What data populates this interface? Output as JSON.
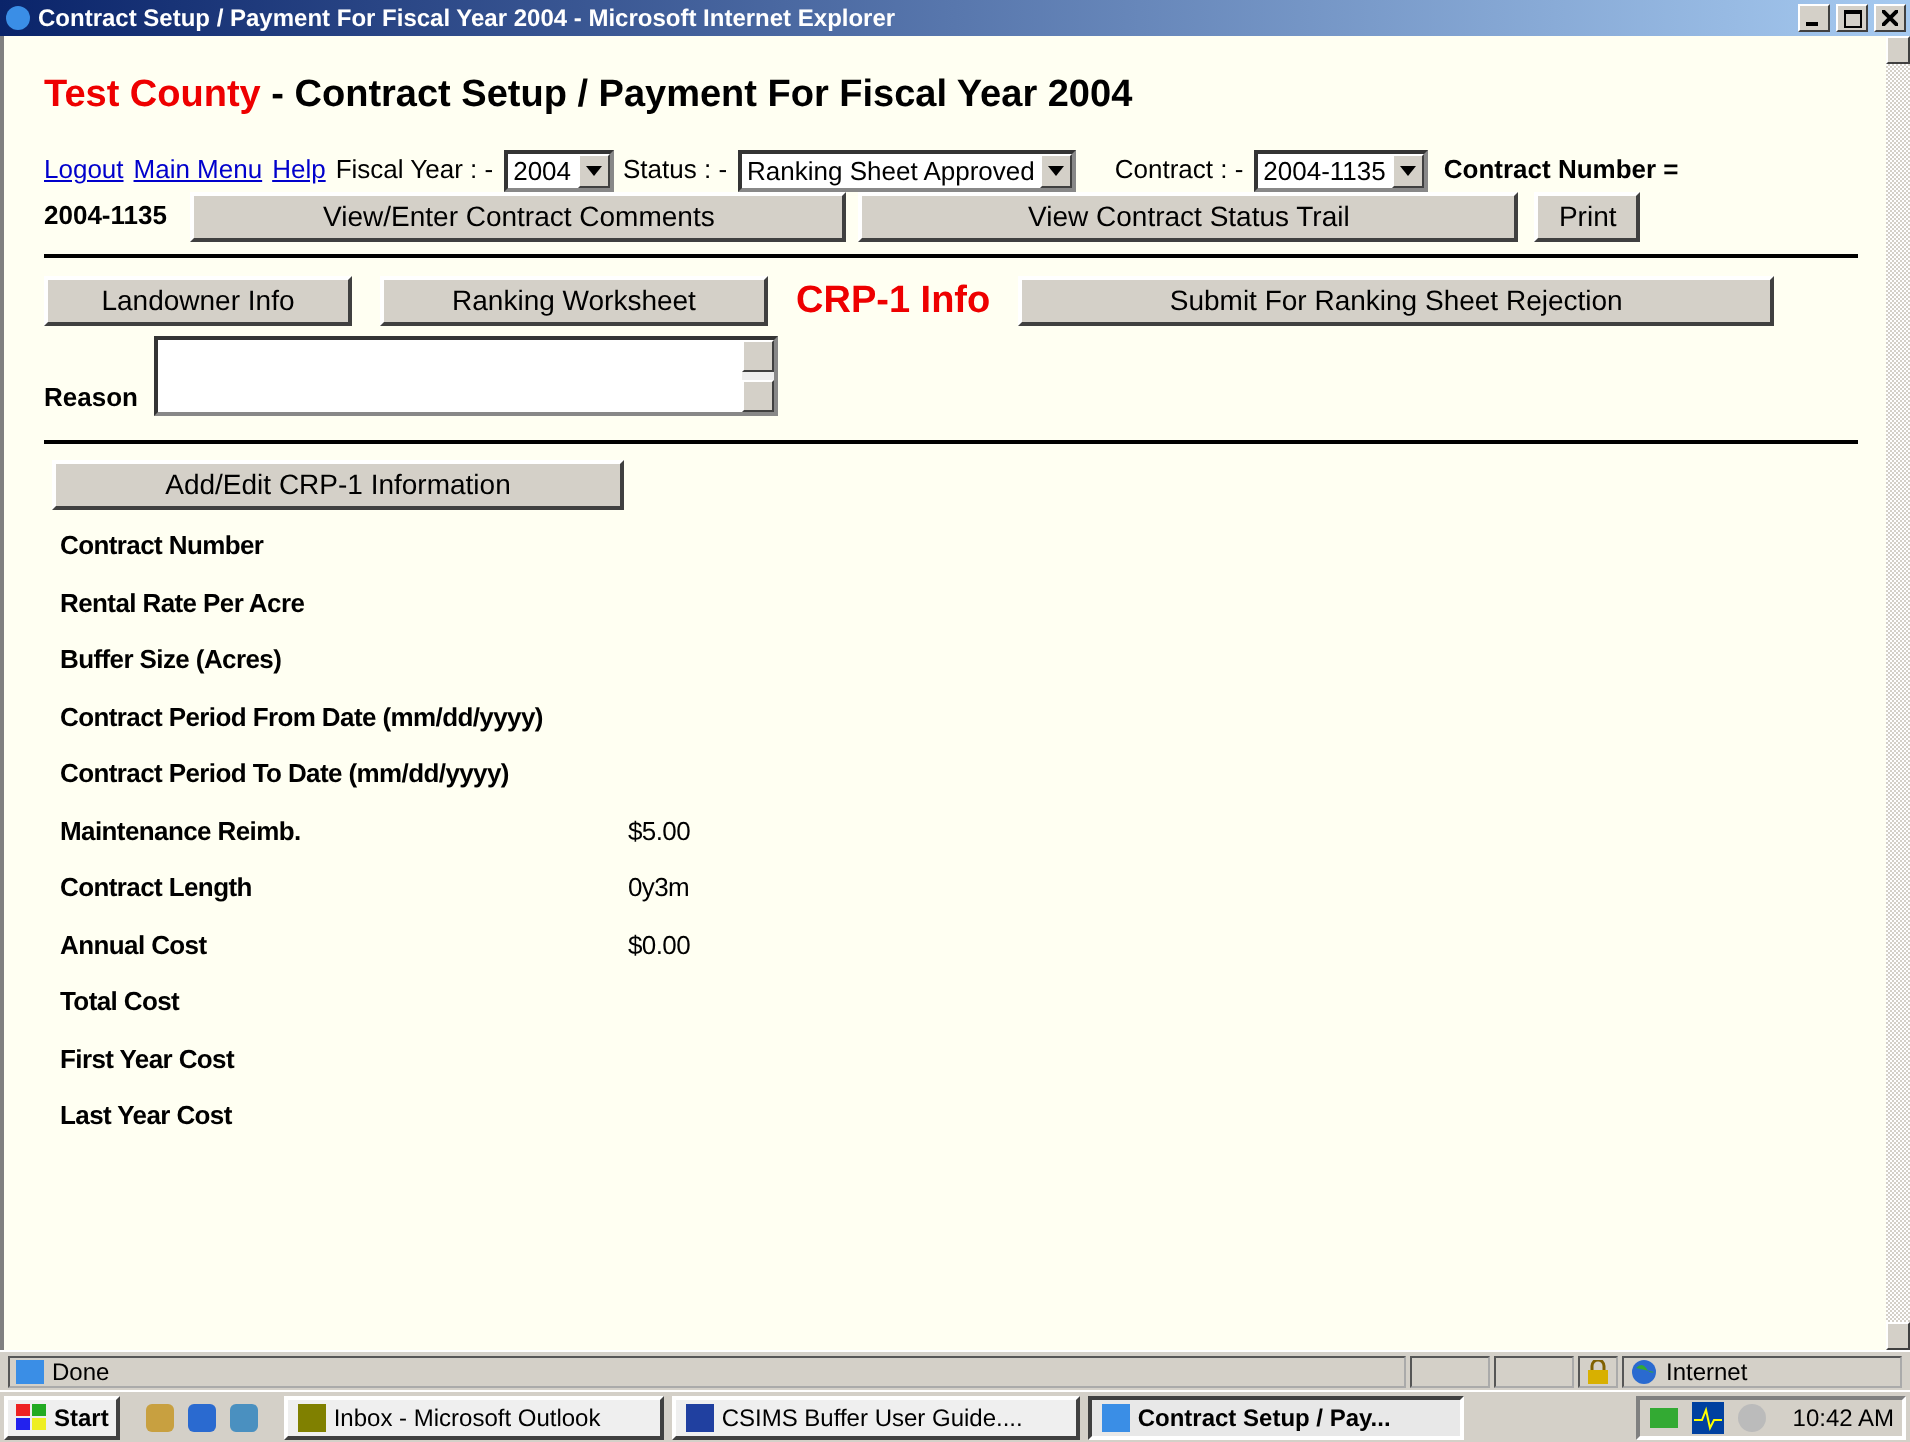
{
  "window": {
    "title": "Contract Setup / Payment For Fiscal Year 2004 - Microsoft Internet Explorer"
  },
  "heading": {
    "county": "Test County",
    "title": "- Contract Setup / Payment For Fiscal Year 2004"
  },
  "links": [
    "Logout",
    "Main Menu",
    "Help"
  ],
  "filters": [
    {
      "label": "Fiscal Year : -",
      "value": "2004"
    },
    {
      "label": "Status : -",
      "value": "Ranking Sheet Approved"
    },
    {
      "label": "Contract : -",
      "value": "2004-1135"
    }
  ],
  "contract_number": {
    "label": "Contract Number =",
    "value": "2004-1135"
  },
  "action_buttons": [
    "View/Enter Contract Comments",
    "View Contract Status Trail",
    "Print"
  ],
  "tabs": [
    {
      "label": "Landowner Info",
      "selected": false
    },
    {
      "label": "Ranking Worksheet",
      "selected": false
    },
    {
      "label": "CRP-1 Info",
      "selected": true
    }
  ],
  "reject_button": "Submit For Ranking Sheet Rejection",
  "reason": {
    "label": "Reason"
  },
  "edit_button": "Add/Edit CRP-1 Information",
  "fields": [
    {
      "label": "Contract Number"
    },
    {
      "label": "Rental Rate Per Acre"
    },
    {
      "label": "Buffer Size (Acres)"
    },
    {
      "label": "Contract Period From Date (mm/dd/yyyy)"
    },
    {
      "label": "Contract Period To Date (mm/dd/yyyy)"
    },
    {
      "label": "Maintenance Reimb.",
      "value": "$5.00"
    },
    {
      "label": "Contract Length",
      "value": "0y3m"
    },
    {
      "label": "Annual Cost",
      "value": "$0.00"
    },
    {
      "label": "Total Cost"
    },
    {
      "label": "First Year Cost"
    },
    {
      "label": "Last Year Cost"
    }
  ],
  "status_bar": {
    "text": "Done",
    "zone": "Internet"
  },
  "taskbar": {
    "start": "Start",
    "tasks": [
      {
        "label": "Inbox - Microsoft Outlook",
        "selected": false
      },
      {
        "label": "CSIMS Buffer User Guide....",
        "selected": false
      },
      {
        "label": "Contract Setup / Pay...",
        "selected": true
      }
    ],
    "clock": "10:42 AM"
  }
}
